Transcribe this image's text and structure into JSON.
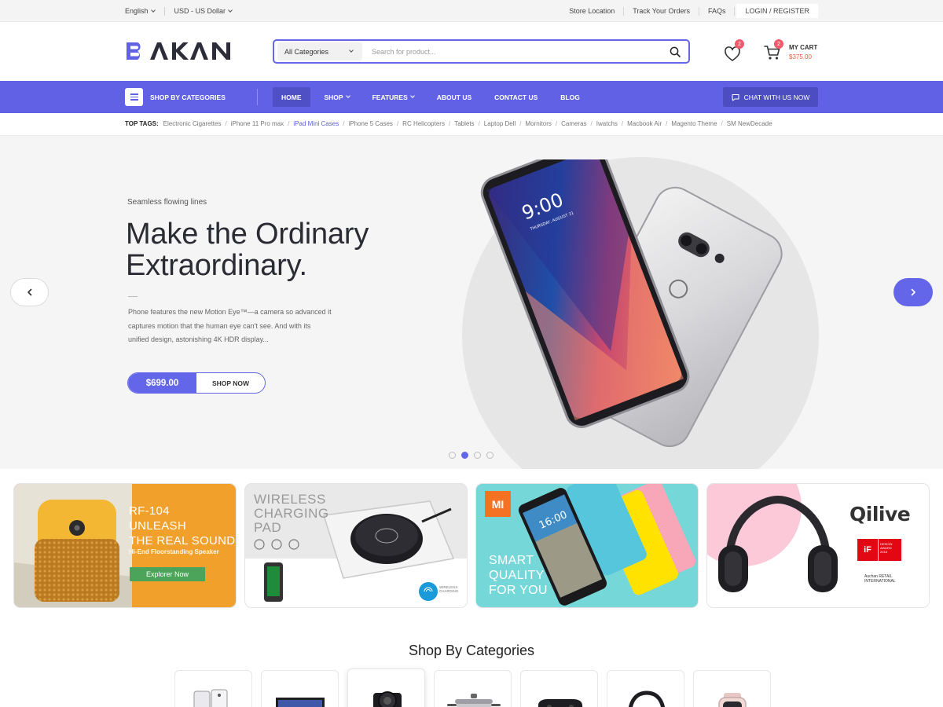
{
  "topbar": {
    "language": "English",
    "currency": "USD - US Dollar",
    "links": [
      "Store Location",
      "Track Your Orders",
      "FAQs"
    ],
    "login": "LOGIN / REGISTER"
  },
  "header": {
    "logo": "BAKAN",
    "search": {
      "category": "All Categories",
      "placeholder": "Search for product..."
    },
    "wishlist_count": "2",
    "cart": {
      "count": "2",
      "label": "MY CART",
      "amount": "$375.00"
    }
  },
  "nav": {
    "categories_label": "SHOP BY CATEGORIES",
    "items": [
      "HOME",
      "SHOP",
      "FEATURES",
      "ABOUT US",
      "CONTACT US",
      "BLOG"
    ],
    "active": "HOME",
    "chat": "CHAT WITH US NOW"
  },
  "tags": {
    "heading": "TOP TAGS:",
    "items": [
      "Electronic Cigarettes",
      "iPhone 11 Pro max",
      "iPad Mini Cases",
      "iPhone 5 Cases",
      "RC Helicopters",
      "Tablets",
      "Laptop Dell",
      "Mornitors",
      "Cameras",
      "Iwatchs",
      "Macbook Air",
      "Magento Theme",
      "SM NewDecade"
    ],
    "highlighted": "iPad Mini Cases"
  },
  "hero": {
    "kicker": "Seamless flowing lines",
    "title_line1": "Make the Ordinary",
    "title_line2": "Extraordinary.",
    "description": "Phone features the new Motion Eye™—a camera so advanced it captures motion that the human eye can't see. And with its unified design, astonishing 4K HDR display...",
    "price": "$699.00",
    "cta": "SHOP NOW",
    "phone_time": "9:00",
    "phone_date": "THURSDAY, AUGUST 31",
    "slides_total": 4,
    "active_slide": 2
  },
  "banners": {
    "b1": {
      "line1": "RF-104",
      "line2": "UNLEASH",
      "line3": "THE REAL SOUND",
      "subtitle": "Hi-End Floorstanding Speaker",
      "button": "Explorer Now"
    },
    "b2": {
      "line1": "WIRELESS",
      "line2": "CHARGING",
      "line3": "PAD",
      "badge1": "WIRELESS",
      "badge2": "CHARGING"
    },
    "b3": {
      "logo": "MI",
      "line1": "SMART",
      "line2": "QUALITY",
      "line3": "FOR YOU",
      "phone_time": "16:00"
    },
    "b4": {
      "brand": "Qilive",
      "award_mark": "iF",
      "award1": "DESIGN",
      "award2": "AWARD",
      "award3": "2018",
      "retailer": "Auchan RETAIL",
      "retailer_sub": "INTERNATIONAL"
    }
  },
  "categories": {
    "title": "Shop By Categories",
    "icons": [
      "phones-icon",
      "laptop-icon",
      "camera-icon",
      "cookware-icon",
      "gamepad-icon",
      "headphones-icon",
      "smartwatch-icon"
    ]
  },
  "colors": {
    "accent": "#6061e4",
    "accent_dark": "#4f4fc6",
    "badge": "#f05a6d",
    "price_orange": "#f05a36"
  }
}
